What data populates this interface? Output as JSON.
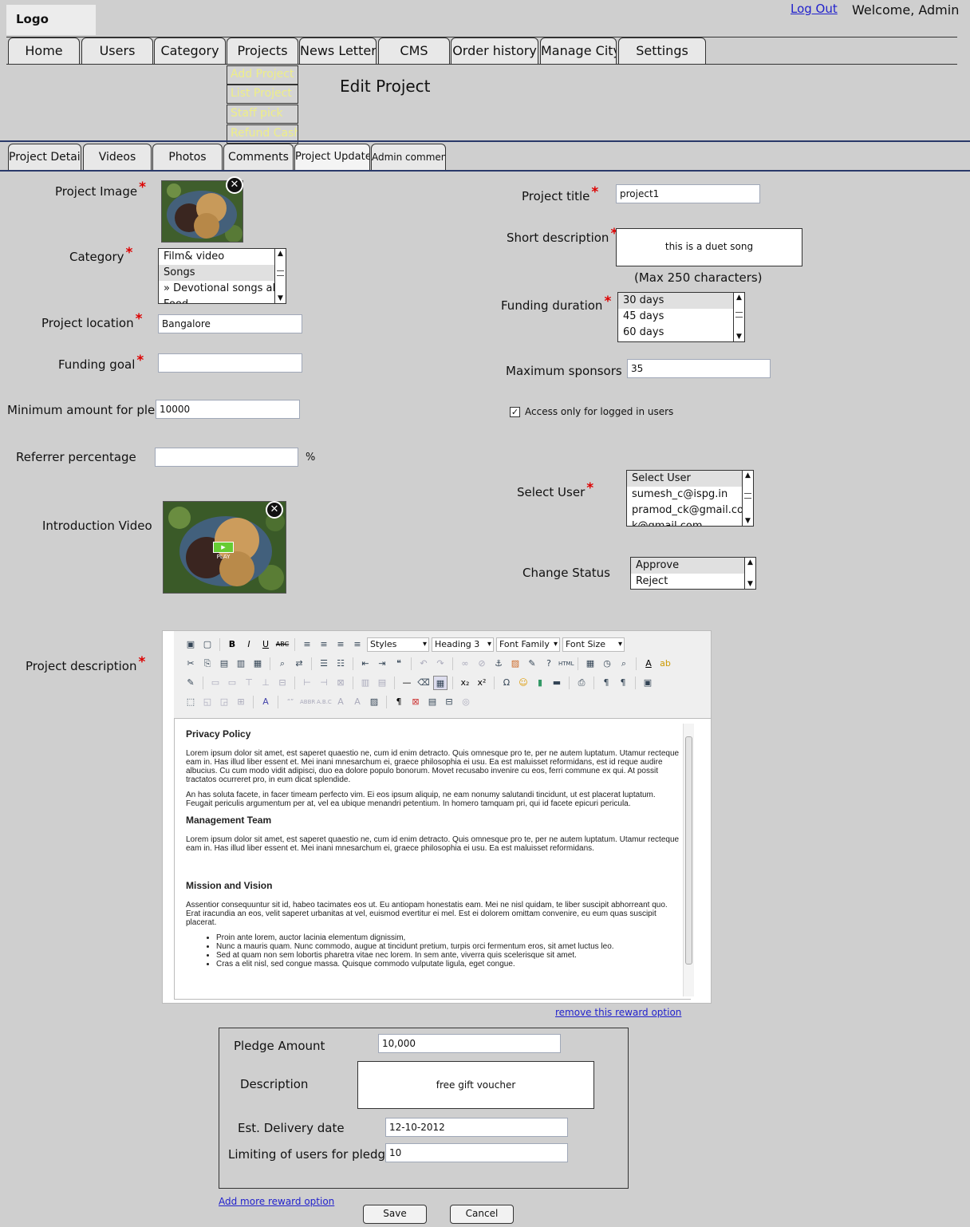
{
  "header": {
    "logo": "Logo",
    "logout": "Log Out",
    "welcome": "Welcome, Admin"
  },
  "nav": {
    "tabs": [
      "Home",
      "Users",
      "Category",
      "Projects",
      "News Letter",
      "CMS",
      "Order history",
      "Manage City",
      "Settings"
    ],
    "projects_menu": [
      "Add Project",
      "List Project",
      "Staff pick",
      "Refund Cash"
    ]
  },
  "page_title": "Edit Project",
  "subtabs": [
    "Project Details",
    "Videos",
    "Photos",
    "Comments",
    "Project Updates",
    "Admin comments"
  ],
  "form": {
    "project_image_label": "Project Image",
    "category_label": "Category",
    "category_options": [
      "Film& video",
      "Songs",
      "» Devotional songs album",
      "Food"
    ],
    "category_selected": "Songs",
    "location_label": "Project location",
    "location_value": "Bangalore",
    "funding_goal_label": "Funding goal",
    "funding_goal_value": "",
    "min_pledge_label": "Minimum amount for pledge",
    "min_pledge_value": "10000",
    "referrer_label": "Referrer percentage",
    "referrer_value": "",
    "percent_sign": "%",
    "intro_video_label": "Introduction Video",
    "title_label": "Project title",
    "title_value": "project1",
    "short_desc_label": "Short description",
    "short_desc_value": "this is a duet song",
    "max_chars_note": "(Max 250 characters)",
    "funding_duration_label": "Funding duration",
    "funding_duration_options": [
      "30 days",
      "45 days",
      "60 days"
    ],
    "funding_duration_selected": "30 days",
    "max_sponsors_label": "Maximum sponsors",
    "max_sponsors_value": "35",
    "access_label": "Access only for logged in users",
    "access_checked": true,
    "select_user_label": "Select User",
    "user_options": [
      "Select User",
      "sumesh_c@ispg.in",
      "pramod_ck@gmail.com",
      "k@gmail.com"
    ],
    "change_status_label": "Change Status",
    "status_options": [
      "Approve",
      "Reject"
    ],
    "description_label": "Project description"
  },
  "editor": {
    "selects": [
      "Styles",
      "Heading 3",
      "Font Family",
      "Font Size"
    ],
    "content": {
      "h1": "Privacy Policy",
      "p1": "Lorem ipsum dolor sit amet, est saperet quaestio ne, cum id enim detracto. Quis omnesque pro te, per ne autem luptatum. Utamur recteque eam in. Has illud liber essent et. Mei inani mnesarchum ei, graece philosophia ei usu. Ea est maluisset reformidans, est id reque audire albucius. Cu cum modo vidit adipisci, duo ea dolore populo bonorum. Movet recusabo invenire cu eos, ferri commune ex qui. At possit tractatos ocurreret pro, in eum dicat splendide.",
      "p2": "An has soluta facete, in facer timeam perfecto vim. Ei eos ipsum aliquip, ne eam nonumy salutandi tincidunt, ut est placerat luptatum. Feugait periculis argumentum per at, vel ea ubique menandri petentium. In homero tamquam pri, qui id facete epicuri pericula.",
      "h2": "Management Team",
      "p3": "Lorem ipsum dolor sit amet, est saperet quaestio ne, cum id enim detracto. Quis omnesque pro te, per ne autem luptatum. Utamur recteque eam in. Has illud liber essent et. Mei inani mnesarchum ei, graece philosophia ei usu. Ea est maluisset reformidans.",
      "h3": "Mission and Vision",
      "p4": "Assentior consequuntur sit id, habeo tacimates eos ut. Eu antiopam honestatis eam. Mei ne nisl quidam, te liber suscipit abhorreant quo. Erat iracundia an eos, velit saperet urbanitas at vel, euismod evertitur ei mel. Est ei dolorem omittam convenire, eu eum quas suscipit placerat.",
      "bullets": [
        "Proin ante lorem, auctor lacinia elementum dignissim,",
        "Nunc a mauris quam. Nunc commodo, augue at tincidunt pretium, turpis orci fermentum eros, sit amet luctus leo.",
        "Sed at quam non sem lobortis pharetra vitae nec lorem. In sem ante, viverra quis scelerisque sit amet.",
        "Cras a elit nisl, sed congue massa. Quisque commodo vulputate ligula, eget congue."
      ]
    }
  },
  "reward": {
    "remove_link": "remove this reward option",
    "pledge_label": "Pledge Amount",
    "pledge_value": "10,000",
    "desc_label": "Description",
    "desc_value": "free gift voucher",
    "delivery_label": "Est. Delivery date",
    "delivery_value": "12-10-2012",
    "limit_label": "Limiting of users for pledge",
    "limit_value": "10",
    "add_link": "Add more reward option"
  },
  "buttons": {
    "save": "Save",
    "cancel": "Cancel"
  }
}
